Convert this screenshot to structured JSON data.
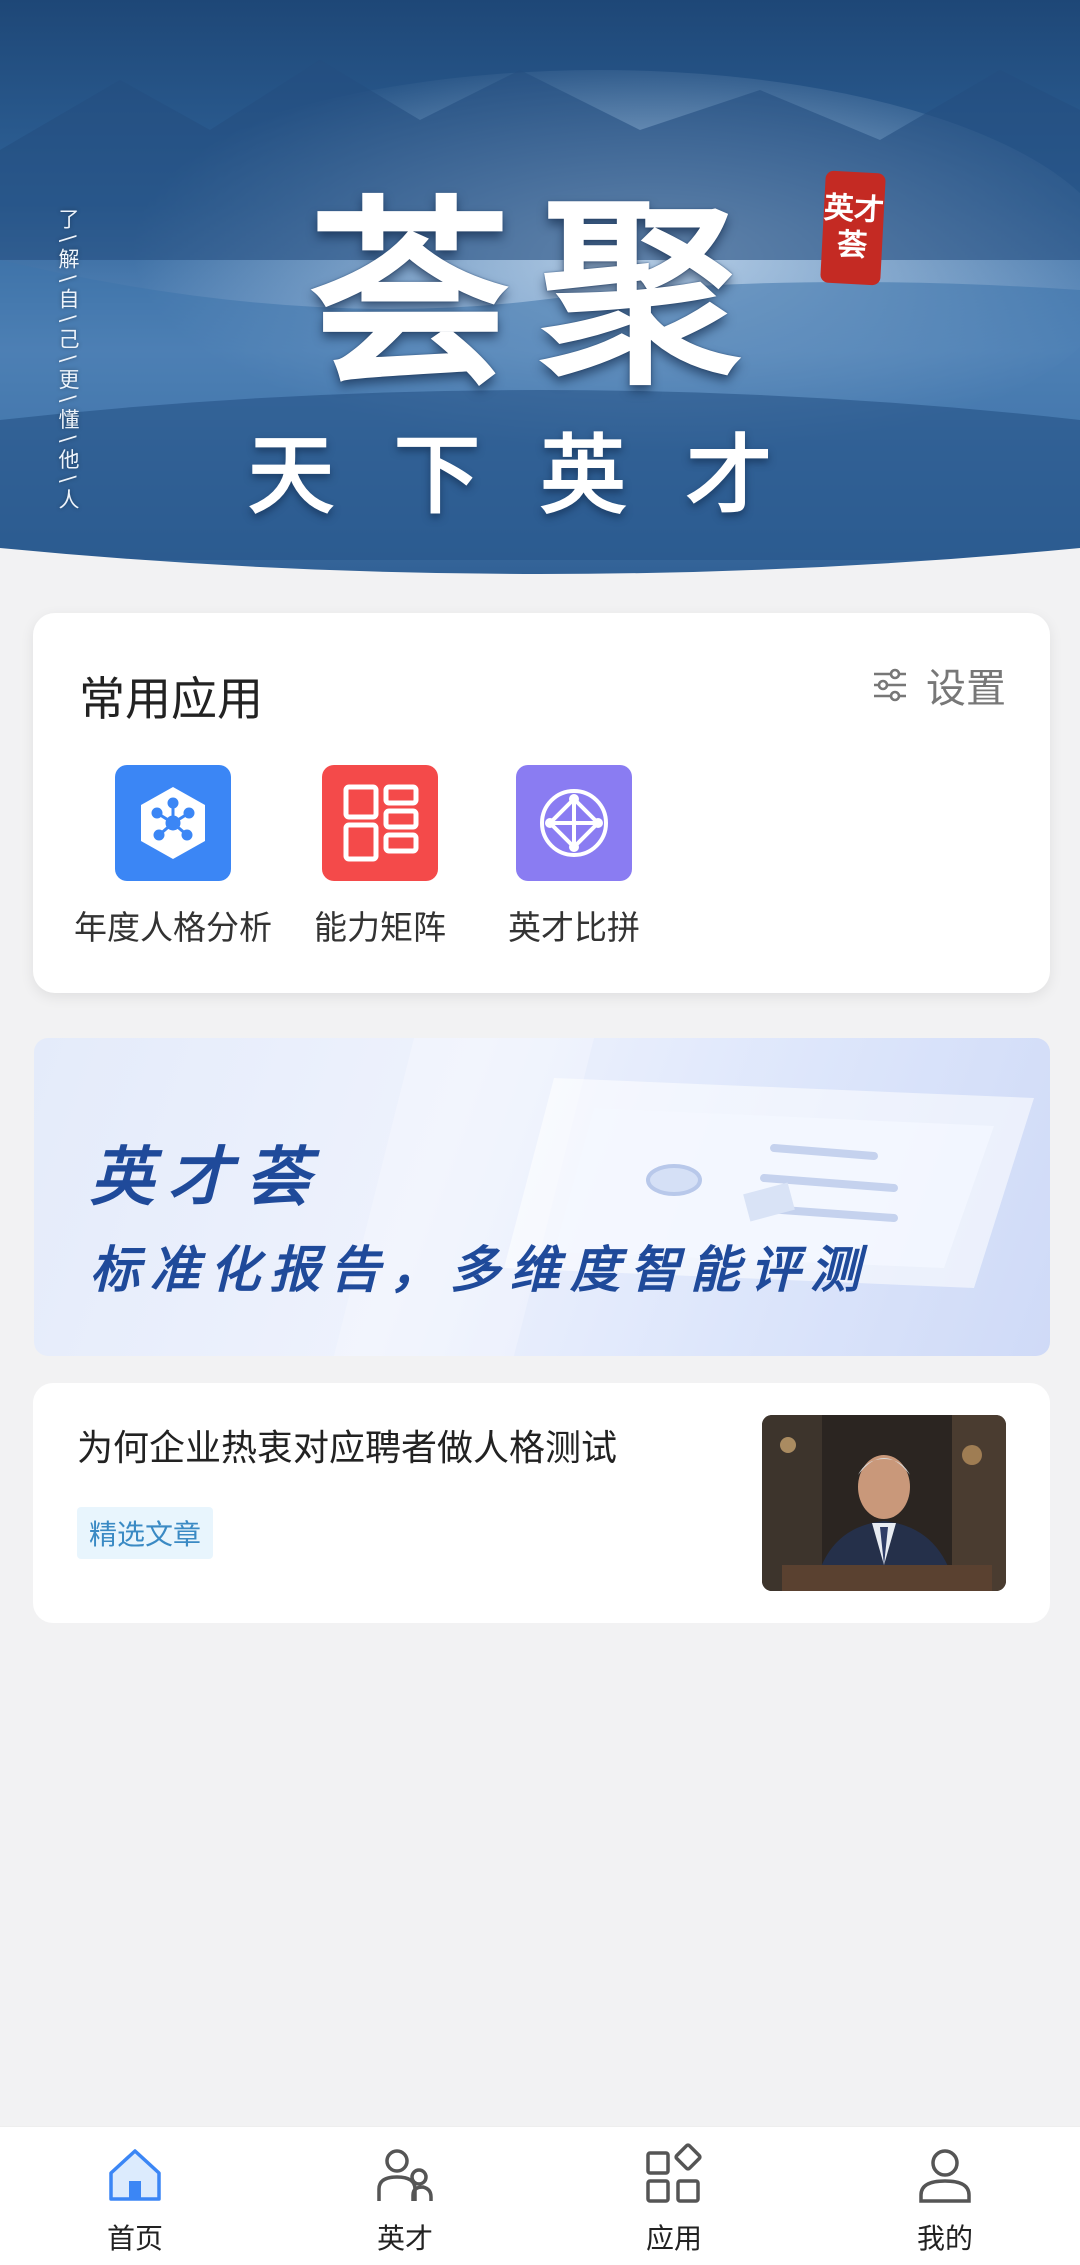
{
  "hero": {
    "vertical_text": "了\\解\\自\\己\\更\\懂\\他\\人",
    "title": "荟聚",
    "subtitle": "天下英才",
    "seal_line1": "英才",
    "seal_line2": "荟"
  },
  "apps": {
    "title": "常用应用",
    "settings_label": "设置",
    "items": [
      {
        "label": "年度人格分析",
        "color": "#3b86f5",
        "icon": "network-hexagon-icon"
      },
      {
        "label": "能力矩阵",
        "color": "#f44a4a",
        "icon": "matrix-grid-icon"
      },
      {
        "label": "英才比拼",
        "color": "#8a7cf2",
        "icon": "compass-circle-icon"
      }
    ]
  },
  "banner": {
    "title": "英才荟",
    "subtitle": "标准化报告，多维度智能评测"
  },
  "article": {
    "title": "为何企业热衷对应聘者做人格测试",
    "tag": "精选文章"
  },
  "tabbar": {
    "active_color": "#3b86f5",
    "items": [
      {
        "label": "首页",
        "icon": "home-icon",
        "active": true
      },
      {
        "label": "英才",
        "icon": "people-icon",
        "active": false
      },
      {
        "label": "应用",
        "icon": "apps-icon",
        "active": false
      },
      {
        "label": "我的",
        "icon": "user-icon",
        "active": false
      }
    ]
  }
}
